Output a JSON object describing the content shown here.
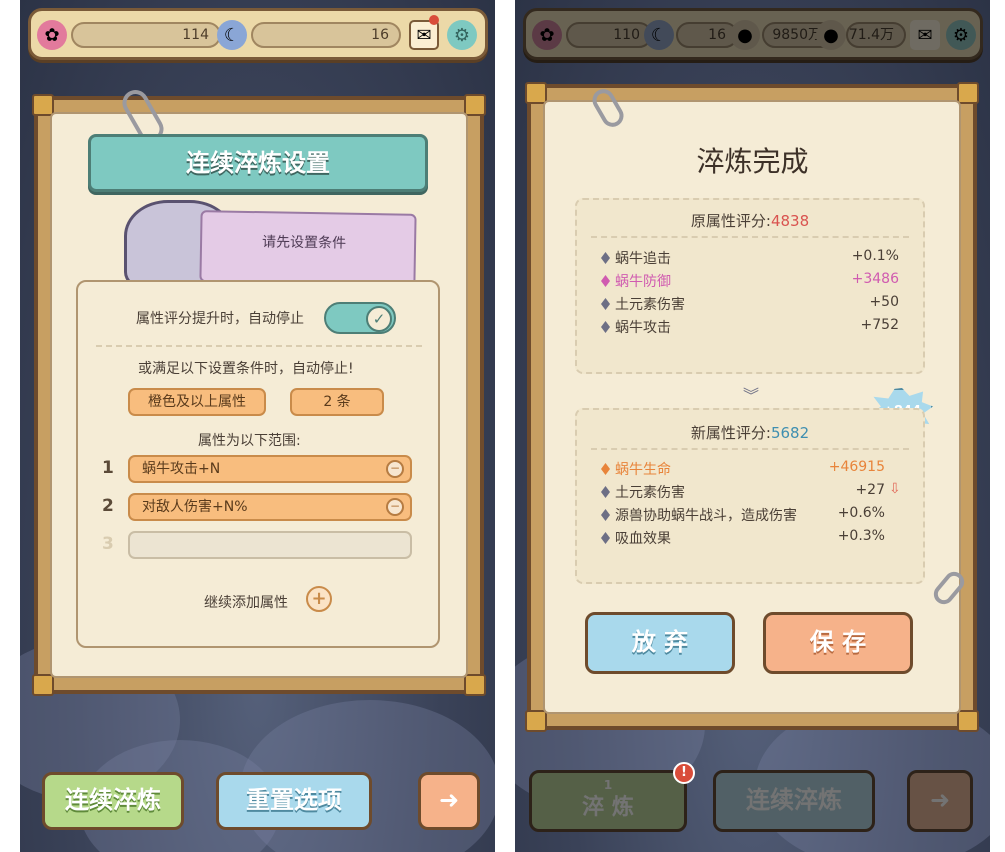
{
  "left": {
    "topbar": {
      "resource1": "114",
      "resource2": "16"
    },
    "title": "连续淬炼设置",
    "condition_card": "请先设置条件",
    "auto_stop_label": "属性评分提升时，自动停止",
    "or_condition_label": "或满足以下设置条件时，自动停止!",
    "filter_rarity": "橙色及以上属性",
    "filter_count": "2 条",
    "range_label": "属性为以下范围:",
    "rows": [
      {
        "num": "1",
        "text": "蜗牛攻击+N"
      },
      {
        "num": "2",
        "text": "对敌人伤害+N%"
      },
      {
        "num": "3",
        "text": ""
      }
    ],
    "add_more": "继续添加属性",
    "bottom_buttons": {
      "continue": "连续淬炼",
      "reset": "重置选项"
    }
  },
  "right": {
    "topbar": {
      "resource1": "110",
      "resource2": "16",
      "resource3": "9850万",
      "resource4": "71.4万"
    },
    "title": "淬炼完成",
    "old_score_label": "原属性评分:",
    "old_score": "4838",
    "old_attrs": [
      {
        "name": "蜗牛追击",
        "value": "+0.1%",
        "color": "#4a3f36"
      },
      {
        "name": "蜗牛防御",
        "value": "+3486",
        "color": "#d05bb0"
      },
      {
        "name": "土元素伤害",
        "value": "+50",
        "color": "#4a3f36"
      },
      {
        "name": "蜗牛攻击",
        "value": "+752",
        "color": "#4a3f36"
      }
    ],
    "badge": "+844",
    "new_score_label": "新属性评分:",
    "new_score": "5682",
    "new_attrs": [
      {
        "name": "蜗牛生命",
        "value": "+46915",
        "color": "#e8843a"
      },
      {
        "name": "土元素伤害",
        "value": "+27",
        "color": "#4a3f36"
      },
      {
        "name": "源兽协助蜗牛战斗，造成伤害",
        "value": "+0.6%",
        "color": "#4a3f36"
      },
      {
        "name": "吸血效果",
        "value": "+0.3%",
        "color": "#4a3f36"
      }
    ],
    "buttons": {
      "discard": "放 弃",
      "save": "保 存"
    },
    "bottom_buttons": {
      "refine_count": "1",
      "refine": "淬 炼",
      "continue": "连续淬炼"
    }
  },
  "colors": {
    "accent_teal": "#7ec9c1",
    "accent_orange": "#f8bd7e",
    "score_red": "#d9534f",
    "score_blue": "#3f8fb0"
  }
}
